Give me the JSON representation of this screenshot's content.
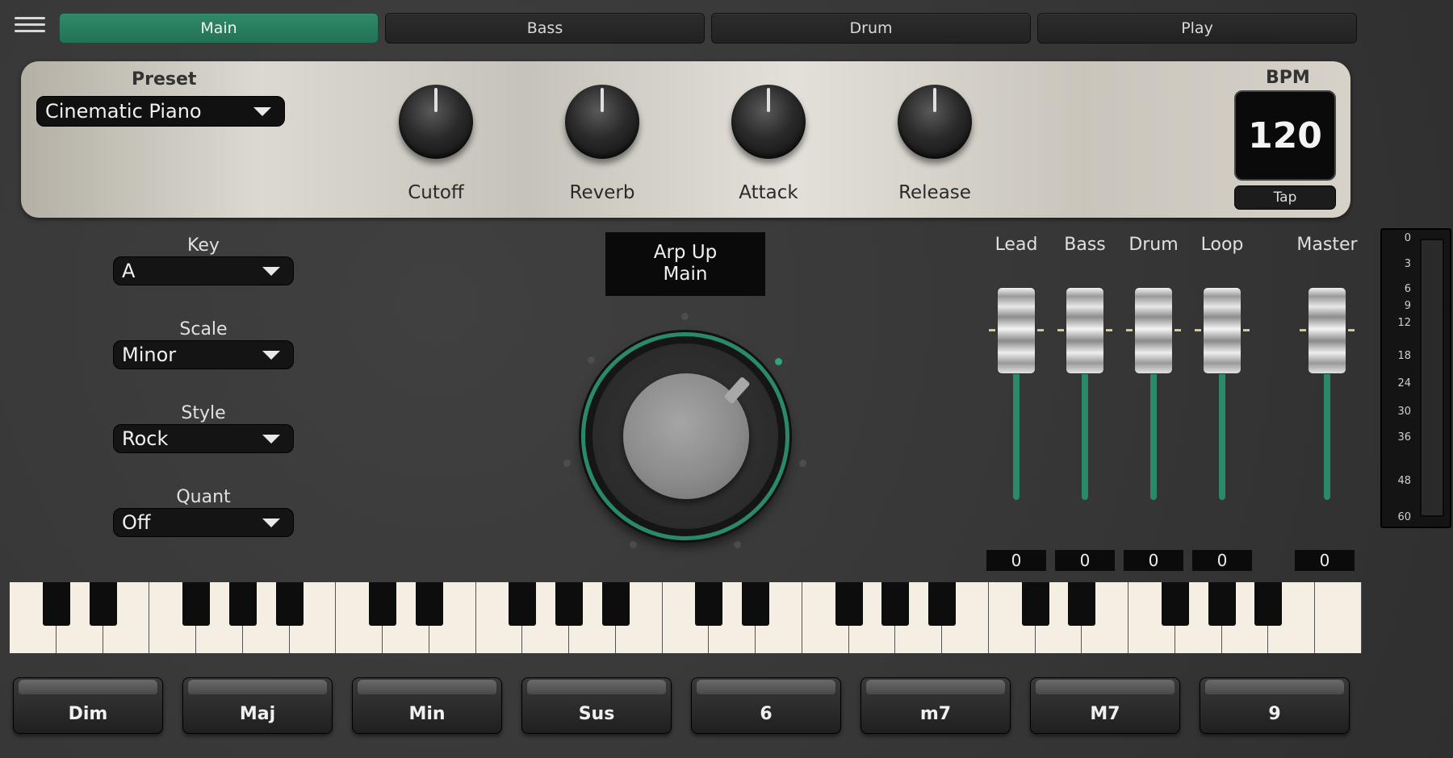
{
  "tabs": [
    {
      "label": "Main",
      "active": true
    },
    {
      "label": "Bass",
      "active": false
    },
    {
      "label": "Drum",
      "active": false
    },
    {
      "label": "Play",
      "active": false
    }
  ],
  "preset": {
    "label": "Preset",
    "value": "Cinematic Piano"
  },
  "knobs": [
    "Cutoff",
    "Reverb",
    "Attack",
    "Release"
  ],
  "bpm": {
    "label": "BPM",
    "value": "120",
    "tap_label": "Tap"
  },
  "controls": {
    "key": {
      "label": "Key",
      "value": "A"
    },
    "scale": {
      "label": "Scale",
      "value": "Minor"
    },
    "style": {
      "label": "Style",
      "value": "Rock"
    },
    "quant": {
      "label": "Quant",
      "value": "Off"
    }
  },
  "arp_display": {
    "line1": "Arp Up",
    "line2": "Main"
  },
  "mixer": {
    "channels": [
      {
        "name": "Lead",
        "value": "0"
      },
      {
        "name": "Bass",
        "value": "0"
      },
      {
        "name": "Drum",
        "value": "0"
      },
      {
        "name": "Loop",
        "value": "0"
      }
    ],
    "master": {
      "name": "Master",
      "value": "0"
    }
  },
  "meter_scale": [
    "0",
    "3",
    "6",
    "9",
    "12",
    "18",
    "24",
    "30",
    "36",
    "48",
    "60"
  ],
  "chords": [
    "Dim",
    "Maj",
    "Min",
    "Sus",
    "6",
    "m7",
    "M7",
    "9"
  ],
  "colors": {
    "accent": "#2a8a68",
    "panel": "#d6d2c9",
    "background": "#3a3a3a"
  }
}
